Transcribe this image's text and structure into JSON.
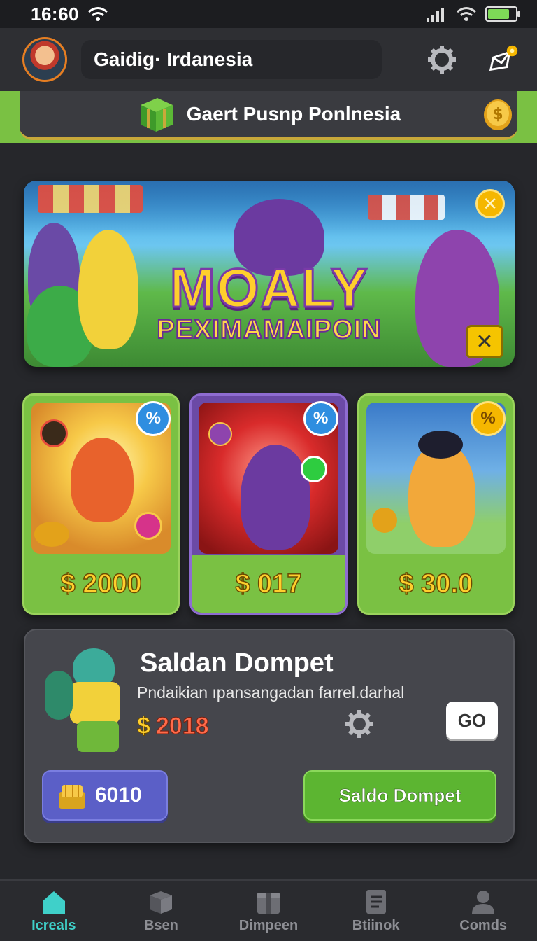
{
  "status_bar": {
    "time": "16:60",
    "icons": [
      "wifi-icon",
      "signal-icon",
      "battery-icon"
    ],
    "battery_color": "#7ed957"
  },
  "header": {
    "title": "Gaidig· Irdanesia",
    "actions": [
      "settings-icon",
      "edit-icon"
    ]
  },
  "promo": {
    "text": "Gaert Pusnp Ponlnesia",
    "icons": [
      "gift-box-icon",
      "coin-icon"
    ]
  },
  "banner": {
    "title": "MOALY",
    "subtitle": "PEXIMAMAIPOIN"
  },
  "cards": [
    {
      "price": "$ 2000",
      "badge": "%",
      "badge_color": "#2f8ee0"
    },
    {
      "price": "$ 017",
      "badge": "%",
      "badge_color": "#2f8ee0"
    },
    {
      "price": "$ 30.0",
      "badge": "%",
      "badge_color": "#f5b700"
    }
  ],
  "wallet": {
    "title": "Saldan Dompet",
    "description": "Pndaikian ıpansangadan farrel.darhal",
    "amount_symbol": "$",
    "amount": "2018",
    "go_label": "GO",
    "coin_button_label": "6010",
    "saldo_button_label": "Saldo Dompet"
  },
  "bottom_nav": {
    "items": [
      {
        "label": "Icreals",
        "icon": "home-icon",
        "active": true
      },
      {
        "label": "Bsen",
        "icon": "box-icon",
        "active": false
      },
      {
        "label": "Dimpeen",
        "icon": "package-icon",
        "active": false
      },
      {
        "label": "Btiinok",
        "icon": "document-icon",
        "active": false
      },
      {
        "label": "Comds",
        "icon": "profile-icon",
        "active": false
      }
    ],
    "active_color": "#3fd0c9"
  }
}
